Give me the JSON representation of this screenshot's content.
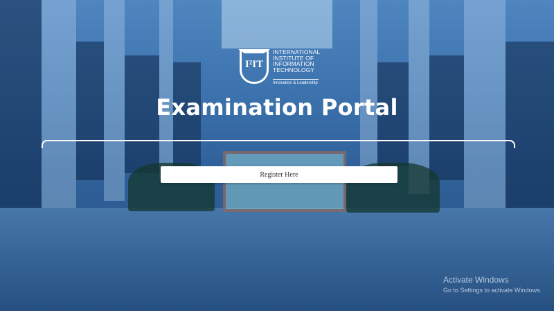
{
  "logo": {
    "mark": "I²IT",
    "name_lines": [
      "INTERNATIONAL",
      "INSTITUTE OF",
      "INFORMATION",
      "TECHNOLOGY"
    ],
    "tagline": "Innovation & Leadership"
  },
  "page_title": "Examination Portal",
  "register_button_label": "Register Here",
  "os_watermark": {
    "line1": "Activate Windows",
    "line2": "Go to Settings to activate Windows."
  },
  "colors": {
    "overlay": "#3c72ad",
    "text": "#ffffff",
    "button_bg": "#ffffff"
  }
}
